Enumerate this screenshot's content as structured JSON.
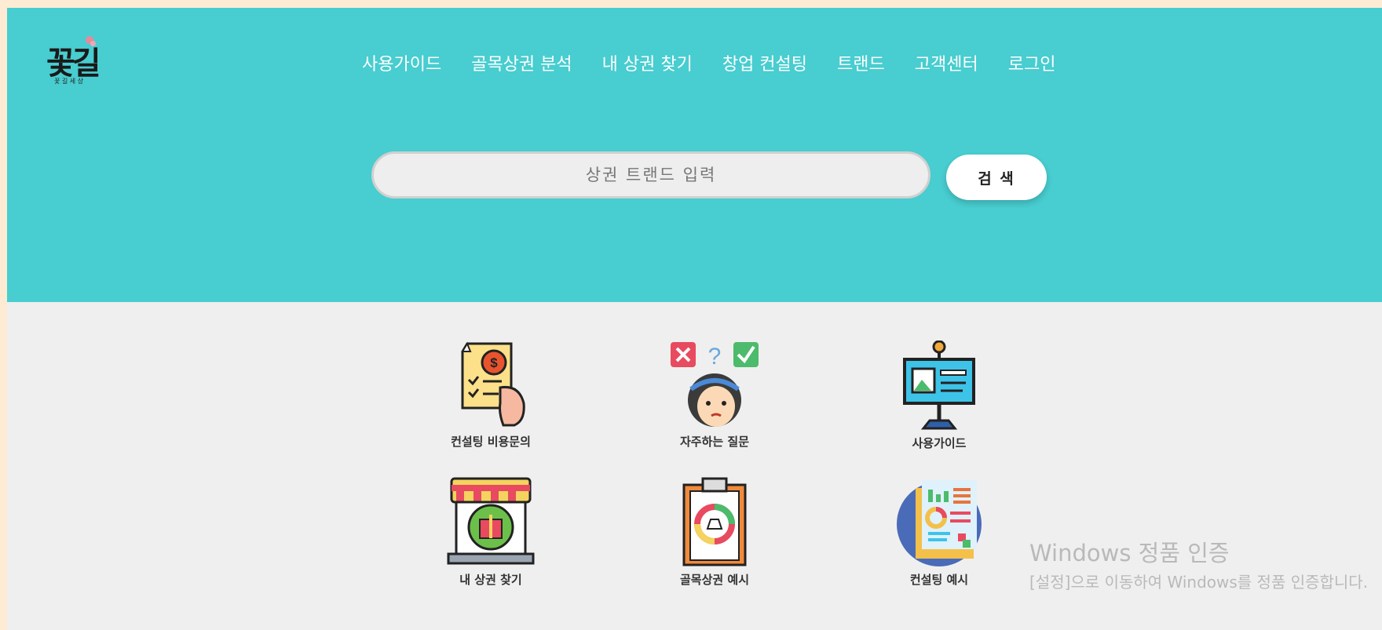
{
  "logo": {
    "text": "꽃길",
    "subtitle": "꽃 길 세 상"
  },
  "nav": {
    "items": [
      "사용가이드",
      "골목상권 분석",
      "내 상권 찾기",
      "창업 컨설팅",
      "트랜드",
      "고객센터",
      "로그인"
    ]
  },
  "search": {
    "placeholder": "상권 트랜드 입력",
    "button_label": "검 색"
  },
  "tiles": [
    {
      "label": "컨설팅 비용문의",
      "icon": "price-document-icon"
    },
    {
      "label": "자주하는 질문",
      "icon": "faq-person-icon"
    },
    {
      "label": "사용가이드",
      "icon": "presentation-board-icon"
    },
    {
      "label": "내 상권 찾기",
      "icon": "store-icon"
    },
    {
      "label": "골목상권 예시",
      "icon": "clipboard-chart-icon"
    },
    {
      "label": "컨설팅 예시",
      "icon": "report-chart-icon"
    }
  ],
  "watermark": {
    "title": "Windows 정품 인증",
    "description": "[설정]으로 이동하여 Windows를 정품 인증합니다."
  },
  "colors": {
    "hero": "#48cdd0",
    "background": "#efefef",
    "outer": "#fdebd3"
  }
}
